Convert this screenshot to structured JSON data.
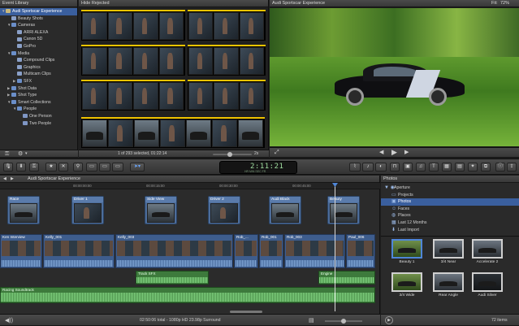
{
  "library": {
    "header": "Event Library",
    "items": [
      {
        "label": "Audi Sportscar Experience",
        "indent": 0,
        "icon": "event",
        "selected": true,
        "expanded": true
      },
      {
        "label": "Beauty Shots",
        "indent": 1,
        "icon": "keyword"
      },
      {
        "label": "Cameras",
        "indent": 1,
        "icon": "folder",
        "expanded": true
      },
      {
        "label": "ARRI ALEXA",
        "indent": 2,
        "icon": "keyword"
      },
      {
        "label": "Canon 5D",
        "indent": 2,
        "icon": "keyword"
      },
      {
        "label": "GoPro",
        "indent": 2,
        "icon": "keyword"
      },
      {
        "label": "Media",
        "indent": 1,
        "icon": "folder",
        "expanded": true
      },
      {
        "label": "Compound Clips",
        "indent": 2,
        "icon": "keyword"
      },
      {
        "label": "Graphics",
        "indent": 2,
        "icon": "keyword"
      },
      {
        "label": "Multicam Clips",
        "indent": 2,
        "icon": "keyword"
      },
      {
        "label": "SFX",
        "indent": 2,
        "icon": "folder",
        "collapsed": true
      },
      {
        "label": "Shot Data",
        "indent": 1,
        "icon": "folder",
        "collapsed": true
      },
      {
        "label": "Shot Type",
        "indent": 1,
        "icon": "folder",
        "collapsed": true
      },
      {
        "label": "Smart Collections",
        "indent": 1,
        "icon": "folder",
        "expanded": true
      },
      {
        "label": "People",
        "indent": 2,
        "icon": "folder",
        "expanded": true
      },
      {
        "label": "One Person",
        "indent": 3,
        "icon": "smart"
      },
      {
        "label": "Two People",
        "indent": 3,
        "icon": "smart"
      }
    ]
  },
  "browser": {
    "filter": "Hide Rejected",
    "status": "1 of 293 selected, 01:22:14",
    "duration": "2s"
  },
  "viewer": {
    "title": "Audi Sportscar Experience",
    "fit_label": "Fit:",
    "fit_value": "72%"
  },
  "toolbar": {
    "timecode": "2:11:21",
    "timecode_units": "HR  MIN  SEC  FR",
    "project": "Audi Sportscar Experience"
  },
  "timeline": {
    "ruler": [
      "00:00:00:00",
      "00:00:15:00",
      "00:00:30:00",
      "00:00:45:00"
    ],
    "connected": [
      {
        "label": "Race"
      },
      {
        "label": "Driver 1"
      },
      {
        "label": "Side View"
      },
      {
        "label": "Driver 2"
      },
      {
        "label": "Audi Black"
      },
      {
        "label": "Beauty"
      }
    ],
    "primary": [
      {
        "label": "Ken Interview"
      },
      {
        "label": "Kelly_001"
      },
      {
        "label": "Kelly_003"
      },
      {
        "label": "Rob_..."
      },
      {
        "label": "Rob_001"
      },
      {
        "label": "Rob_003"
      },
      {
        "label": "Paul_006"
      }
    ],
    "audio": [
      {
        "label": "Track SFX"
      },
      {
        "label": "Engine"
      },
      {
        "label": "Racing Soundtrack"
      }
    ],
    "status": "02:50:06 total - 1080p HD 23.98p Surround"
  },
  "photos": {
    "header": "Photos",
    "sources": [
      {
        "label": "Aperture",
        "level": 0,
        "icon": "aperture"
      },
      {
        "label": "Projects",
        "level": 1,
        "icon": "folder"
      },
      {
        "label": "Photos",
        "level": 1,
        "icon": "photos",
        "selected": true
      },
      {
        "label": "Faces",
        "level": 1,
        "icon": "faces"
      },
      {
        "label": "Places",
        "level": 1,
        "icon": "places"
      },
      {
        "label": "Last 12 Months",
        "level": 1,
        "icon": "calendar"
      },
      {
        "label": "Last Import",
        "level": 1,
        "icon": "import"
      }
    ],
    "grid": [
      {
        "label": "Beauty 1",
        "tone": "green",
        "selected": true
      },
      {
        "label": "3/4 Near",
        "tone": "car"
      },
      {
        "label": "Accelerate 2",
        "tone": "car"
      },
      {
        "label": "3/4 Wide",
        "tone": "green"
      },
      {
        "label": "Rear Angle",
        "tone": "car"
      },
      {
        "label": "Audi Silver",
        "tone": "dark"
      }
    ],
    "count": "72 items"
  },
  "colors": {
    "accent": "#3a5f9e",
    "primary_clip": "#3e5d8d",
    "audio_clip": "#3d7a3c",
    "timecode": "#9fdc9f"
  }
}
